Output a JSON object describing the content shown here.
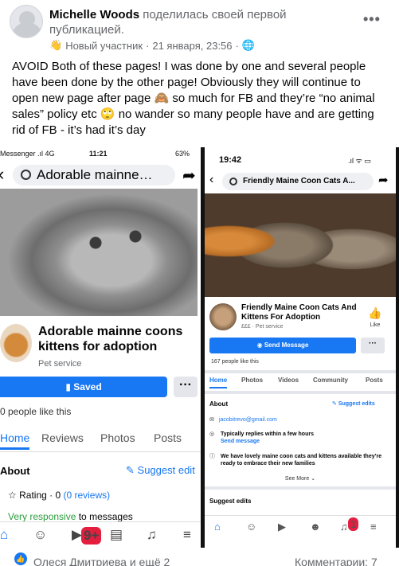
{
  "post": {
    "author": "Michelle Woods",
    "action": "поделилась своей первой публикацией.",
    "badge": "Новый участник",
    "date": "21 января, 23:56",
    "text": "AVOID Both of these pages! I was done by one and several people have been done by the other page! Obviously they will continue to open new page after page 🙈 so much for FB and they’re “no animal sales” policy etc 🙄 no wander so many people have and are getting rid of FB - it’s had it’s day"
  },
  "left_screen": {
    "carrier": "Messenger .ıl 4G",
    "time": "11:21",
    "battery": "63%",
    "search_text": "Adorable mainne…",
    "page_title": "Adorable mainne coons kittens for adoption",
    "category": "Pet service",
    "saved_label": "Saved",
    "likes": "0 people like this",
    "tabs": [
      "Home",
      "Reviews",
      "Photos",
      "Posts"
    ],
    "about": "About",
    "suggest_edit": "Suggest edit",
    "rating_prefix": "Rating · 0 ",
    "rating_reviews": "(0 reviews)",
    "responsive_green": "Very responsive",
    "responsive_rest": " to messages",
    "notification_badge": "9+"
  },
  "right_screen": {
    "time": "19:42",
    "status_icons": ".ıl ᯤ ▭",
    "search_text": "Friendly Maine Coon Cats A...",
    "page_title": "Friendly Maine Coon Cats And Kittens For Adoption",
    "category": "£££ · Pet service",
    "like_label": "Like",
    "send_message": "Send Message",
    "likes": "167 people like this",
    "tabs": [
      "Home",
      "Photos",
      "Videos",
      "Community",
      "Posts"
    ],
    "about": "About",
    "suggest_edits": "Suggest edits",
    "email": "jacobitrevo@gmail.com",
    "reply_title": "Typically replies within a few hours",
    "reply_link": "Send message",
    "description": "We have lovely maine coon cats and kittens available they’re ready to embrace their new families",
    "see_more": "See More ⌄",
    "suggest_edits_section": "Suggest edits",
    "notification_badge": "1"
  },
  "footer": {
    "reactions": "Олеся Дмитриева и ещё 2",
    "comments": "Комментарии: 7"
  },
  "colors": {
    "accent": "#1877f2",
    "muted": "#65676b",
    "badge": "#e41e3f"
  }
}
